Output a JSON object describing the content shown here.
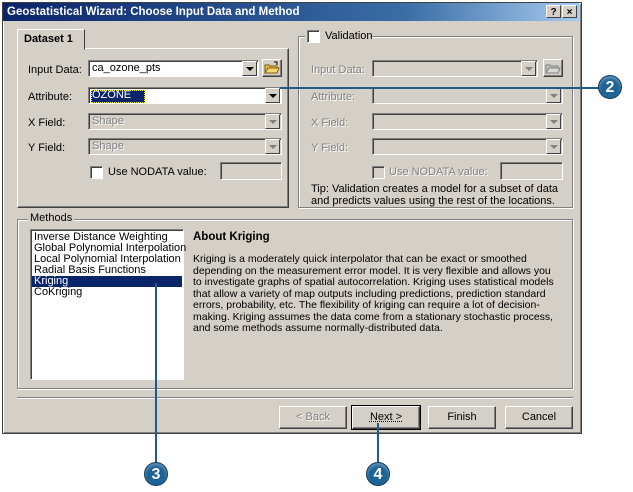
{
  "window": {
    "title": "Geostatistical Wizard: Choose Input Data and Method",
    "help_button": "?",
    "close_button": "×"
  },
  "dataset_tab": {
    "label": "Dataset 1"
  },
  "input_data": {
    "label": "Input Data:",
    "value": "ca_ozone_pts"
  },
  "attribute": {
    "label": "Attribute:",
    "value": "OZONE"
  },
  "x_field": {
    "label": "X Field:",
    "value": "Shape"
  },
  "y_field": {
    "label": "Y Field:",
    "value": "Shape"
  },
  "nodata": {
    "label": "Use NODATA value:",
    "value": ""
  },
  "validation": {
    "label": "Validation",
    "input_data_label": "Input Data:",
    "attribute_label": "Attribute:",
    "x_field_label": "X Field:",
    "y_field_label": "Y Field:",
    "nodata_label": "Use NODATA value:",
    "tip": "Tip:  Validation creates a model for a subset of data and predicts values using the rest of the locations."
  },
  "methods": {
    "label": "Methods",
    "items": [
      "Inverse Distance Weighting",
      "Global Polynomial Interpolation",
      "Local Polynomial Interpolation",
      "Radial Basis Functions",
      "Kriging",
      "CoKriging"
    ],
    "selected": "Kriging",
    "about_title": "About Kriging",
    "about_text": "Kriging is a moderately quick interpolator that can be exact or smoothed depending on the measurement error model. It is very flexible and allows you to investigate graphs of spatial autocorrelation. Kriging uses statistical models that allow a variety of map outputs including predictions, prediction standard errors, probability, etc. The flexibility of kriging can require a lot of decision-making. Kriging assumes the data come from a stationary stochastic process, and some methods assume normally-distributed data."
  },
  "buttons": {
    "back": "< Back",
    "next": "Next >",
    "finish": "Finish",
    "cancel": "Cancel"
  },
  "callouts": [
    "2",
    "3",
    "4"
  ],
  "colors": {
    "title_bar": "#0a246a",
    "selection": "#0a246a",
    "callout": "#1e6296",
    "dialog_face": "#d4d0c8"
  }
}
